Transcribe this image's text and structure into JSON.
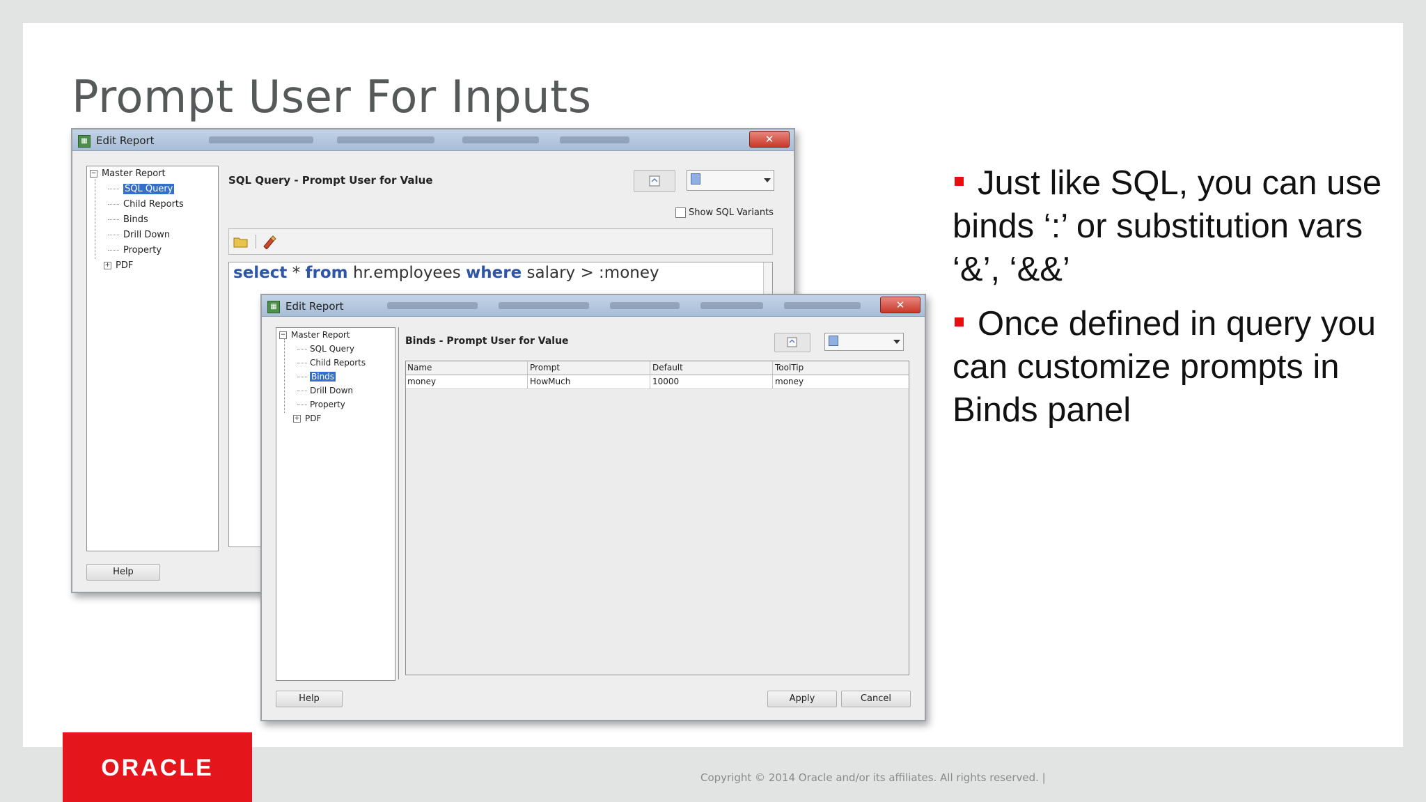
{
  "slide": {
    "title": "Prompt User For Inputs",
    "bullets": [
      "Just like SQL, you can use binds ‘:’ or substitution vars ‘&’, ‘&&’",
      "Once defined in query you can customize prompts in Binds panel"
    ],
    "copyright": "Copyright © 2014 Oracle and/or its affiliates. All rights reserved.  |",
    "logo_text": "ORACLE",
    "colors": {
      "accent_red": "#e4161b",
      "bullet_red": "#e50f0f",
      "title_gray": "#56595a"
    }
  },
  "back_window": {
    "title": "Edit Report",
    "tree": {
      "root": "Master Report",
      "items": [
        "SQL Query",
        "Child Reports",
        "Binds",
        "Drill Down",
        "Property",
        "PDF"
      ],
      "selected": "SQL Query"
    },
    "panel_title": "SQL Query - Prompt User for Value",
    "show_sql_variants_label": "Show SQL Variants",
    "sql": {
      "kw_select": "select",
      "star": " * ",
      "kw_from": "from",
      "table": " hr.employees ",
      "kw_where": "where",
      "condition": " salary > :money"
    },
    "help_button": "Help",
    "icons": [
      "open-folder-icon",
      "eraser-icon",
      "refresh-icon",
      "database-icon"
    ]
  },
  "front_window": {
    "title": "Edit Report",
    "tree": {
      "root": "Master Report",
      "items": [
        "SQL Query",
        "Child Reports",
        "Binds",
        "Drill Down",
        "Property",
        "PDF"
      ],
      "selected": "Binds"
    },
    "panel_title": "Binds - Prompt User for Value",
    "table": {
      "columns": [
        "Name",
        "Prompt",
        "Default",
        "ToolTip"
      ],
      "rows": [
        [
          "money",
          "HowMuch",
          "10000",
          "money"
        ]
      ]
    },
    "help_button": "Help",
    "apply_button": "Apply",
    "cancel_button": "Cancel"
  }
}
